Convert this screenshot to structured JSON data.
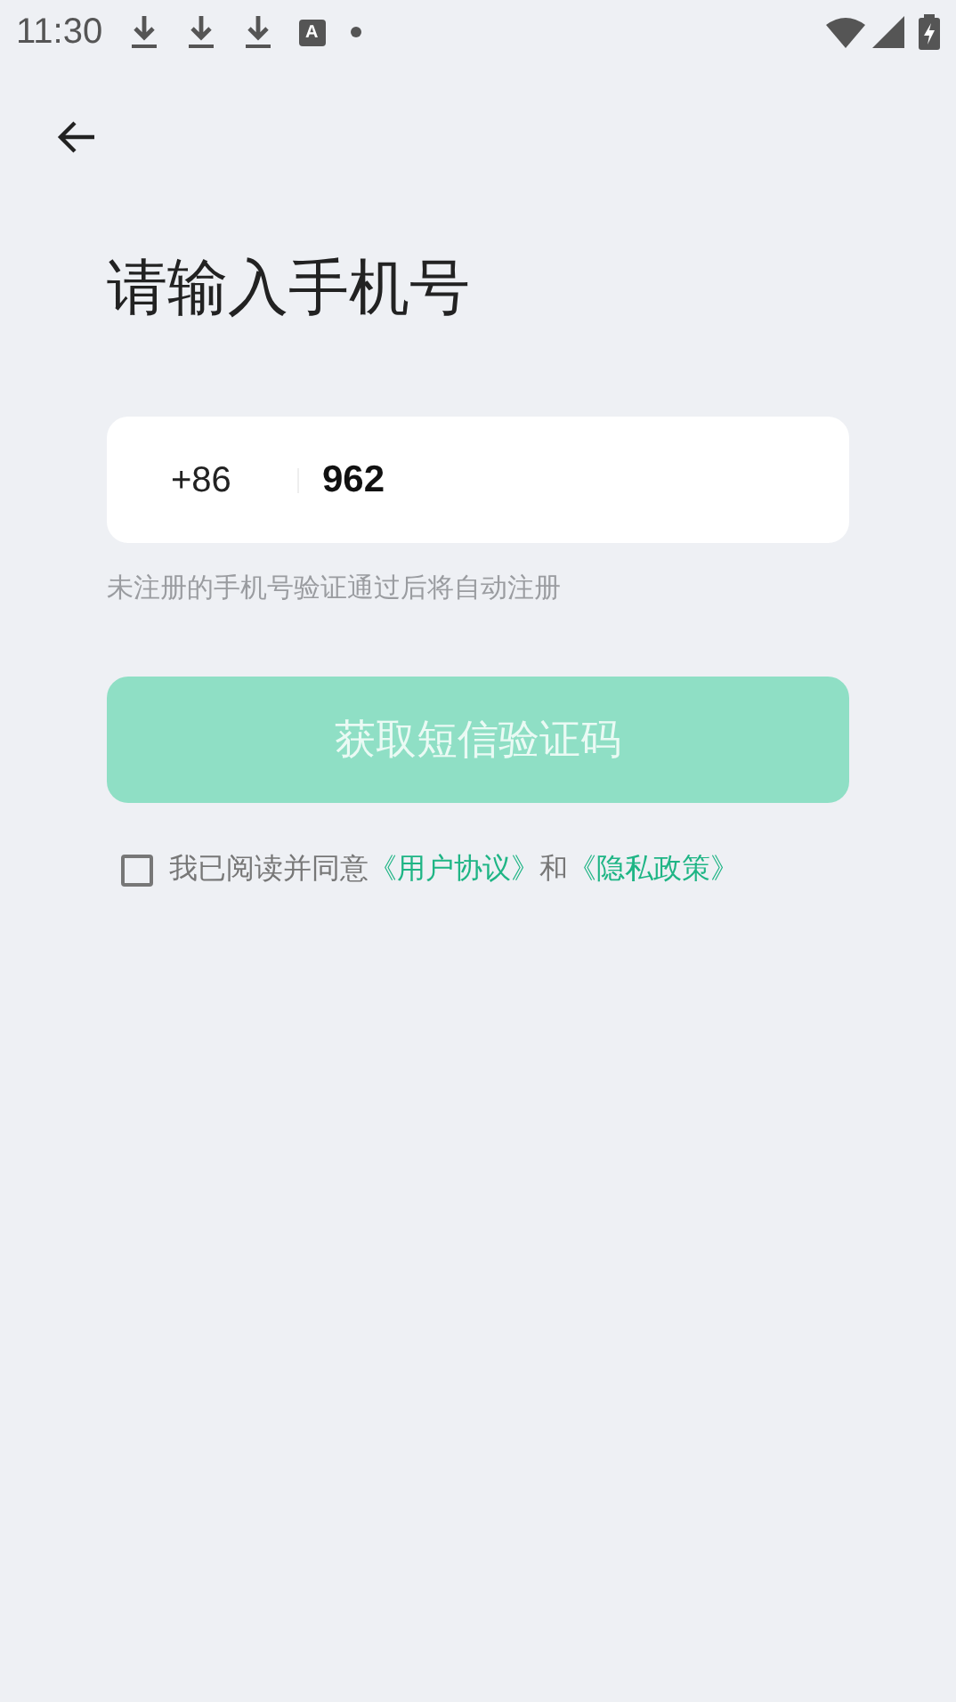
{
  "status_bar": {
    "time": "11:30",
    "notification_letter": "A"
  },
  "title": "请输入手机号",
  "phone_field": {
    "country_code": "+86",
    "value": "962"
  },
  "hint": "未注册的手机号验证通过后将自动注册",
  "submit_button": {
    "label": "获取短信验证码",
    "disabled": true
  },
  "agreement": {
    "checked": false,
    "prefix": "我已阅读并同意",
    "links": [
      "《用户协议》",
      "《隐私政策》"
    ],
    "joiner": "和"
  }
}
